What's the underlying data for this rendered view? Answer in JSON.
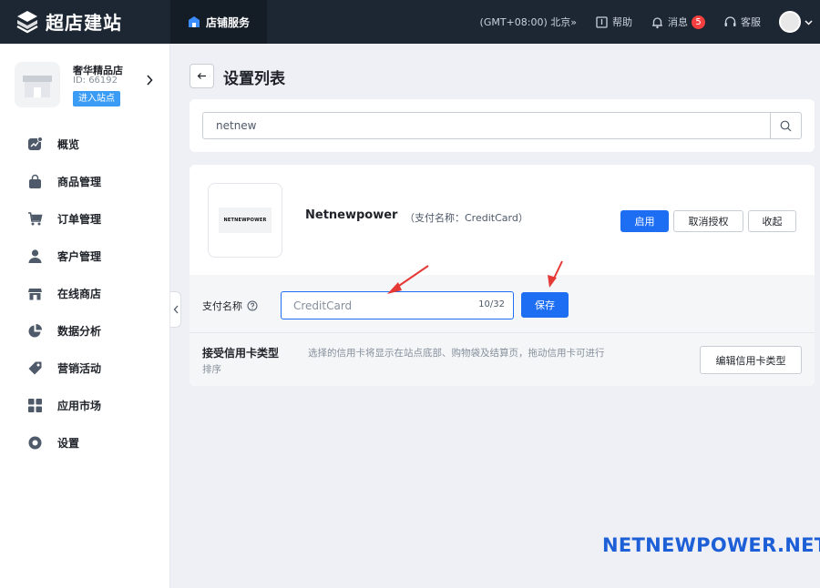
{
  "brand": {
    "name": "超店建站"
  },
  "topbar": {
    "active_tab": "店铺服务",
    "timezone": "(GMT+08:00) 北京»",
    "help": "帮助",
    "messages": "消息",
    "message_count": "5",
    "support": "客服"
  },
  "store": {
    "name": "奢华精品店",
    "id": "ID: 66192",
    "enter": "进入站点"
  },
  "sidebar": {
    "items": [
      {
        "label": "概览",
        "icon": "chart-icon"
      },
      {
        "label": "商品管理",
        "icon": "bag-icon"
      },
      {
        "label": "订单管理",
        "icon": "cart-icon"
      },
      {
        "label": "客户管理",
        "icon": "user-icon"
      },
      {
        "label": "在线商店",
        "icon": "store-icon"
      },
      {
        "label": "数据分析",
        "icon": "pie-icon"
      },
      {
        "label": "营销活动",
        "icon": "tag-icon"
      },
      {
        "label": "应用市场",
        "icon": "apps-icon"
      },
      {
        "label": "设置",
        "icon": "settings-icon"
      }
    ]
  },
  "page": {
    "title": "设置列表",
    "search_value": "netnew"
  },
  "payment": {
    "logo_text": "NETNEWPOWER",
    "name": "Netnewpower",
    "alias": "（支付名称：CreditCard）",
    "enable": "启用",
    "revoke": "取消授权",
    "collapse": "收起",
    "name_label": "支付名称",
    "name_value": "CreditCard",
    "name_count": "10/32",
    "save": "保存",
    "card_types_title": "接受信用卡类型",
    "card_types_desc": "选择的信用卡将显示在站点底部、购物袋及结算页，拖动信用卡可进行",
    "card_types_desc_cont": "排序",
    "edit_card_types": "编辑信用卡类型"
  },
  "watermark": "NETNEWPOWER.NET",
  "colors": {
    "primary": "#1d6ef2",
    "topbar": "#1d2733",
    "annotation_arrow": "#e53935"
  }
}
